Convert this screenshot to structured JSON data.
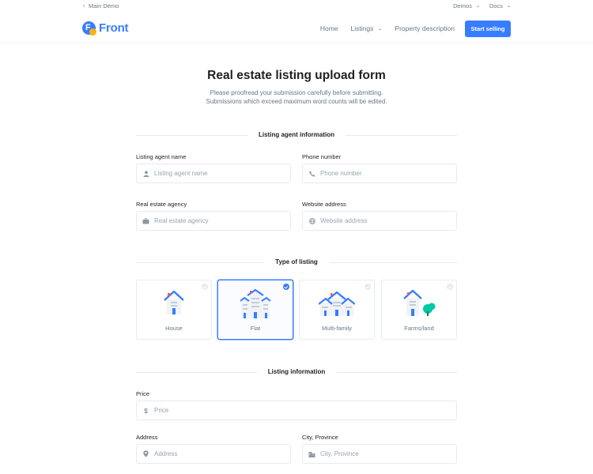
{
  "topbar": {
    "back_label": "Main Demo",
    "links": [
      {
        "label": "Demos"
      },
      {
        "label": "Docs"
      }
    ]
  },
  "navbar": {
    "logo_letter": "F",
    "logo_text": "Front",
    "links": [
      {
        "label": "Home",
        "dropdown": false
      },
      {
        "label": "Listings",
        "dropdown": true
      },
      {
        "label": "Property description",
        "dropdown": false
      }
    ],
    "cta_label": "Start selling"
  },
  "hero": {
    "title": "Real estate listing upload form",
    "subtitle_line1": "Please proofread your submission carefully before submitting.",
    "subtitle_line2": "Submissions which exceed maximum word counts will be edited."
  },
  "sections": {
    "agent": {
      "title": "Listing agent information",
      "agent_name": {
        "label": "Listing agent name",
        "placeholder": "Listing agent name",
        "icon": "user-icon"
      },
      "phone": {
        "label": "Phone number",
        "placeholder": "Phone number",
        "icon": "phone-icon"
      },
      "agency": {
        "label": "Real estate agency",
        "placeholder": "Real estate agency",
        "icon": "briefcase-icon"
      },
      "website": {
        "label": "Website address",
        "placeholder": "Website address",
        "icon": "globe-icon"
      }
    },
    "type": {
      "title": "Type of listing",
      "options": [
        {
          "label": "House",
          "selected": false
        },
        {
          "label": "Flat",
          "selected": true
        },
        {
          "label": "Multi-family",
          "selected": false
        },
        {
          "label": "Farms/land",
          "selected": false
        }
      ]
    },
    "listing": {
      "title": "Listing information",
      "price": {
        "label": "Price",
        "placeholder": "Price",
        "icon": "dollar-icon"
      },
      "address": {
        "label": "Address",
        "placeholder": "Address",
        "icon": "map-pin-icon"
      },
      "city": {
        "label": "City, Province",
        "placeholder": "City, Province",
        "icon": "building-icon"
      }
    }
  },
  "colors": {
    "primary": "#377dff",
    "accent": "#ffb20f",
    "text": "#1e2022",
    "muted": "#677788",
    "border": "#e7eaf3"
  }
}
